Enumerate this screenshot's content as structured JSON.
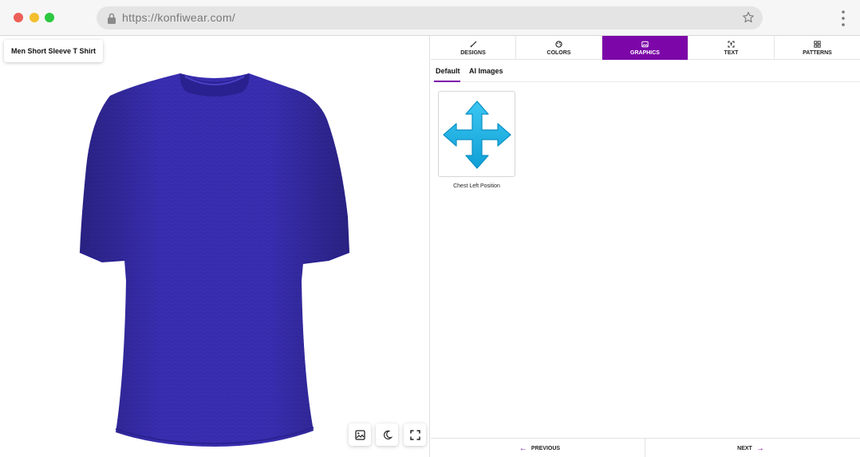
{
  "browser": {
    "url": "https://konfiwear.com/"
  },
  "viewer": {
    "product_label": "Men Short Sleeve T Shirt",
    "shirt_color": "#3a2fb4",
    "buttons": [
      "image-icon",
      "moon-icon",
      "fullscreen-icon"
    ]
  },
  "panel": {
    "accent": "#7c06a8",
    "tabs": [
      {
        "label": "DESIGNS",
        "icon": "brush-icon"
      },
      {
        "label": "COLORS",
        "icon": "palette-icon"
      },
      {
        "label": "GRAPHICS",
        "icon": "image-icon",
        "active": true
      },
      {
        "label": "TEXT",
        "icon": "text-select-icon"
      },
      {
        "label": "PATTERNS",
        "icon": "grid-icon"
      }
    ],
    "subtabs": {
      "default": "Default",
      "ai": "AI Images"
    },
    "graphics": [
      {
        "caption": "Chest Left Position",
        "icon": "move-arrows-icon",
        "color": "#1cb6ea"
      }
    ],
    "footer": {
      "previous": "PREVIOUS",
      "next": "NEXT"
    }
  }
}
